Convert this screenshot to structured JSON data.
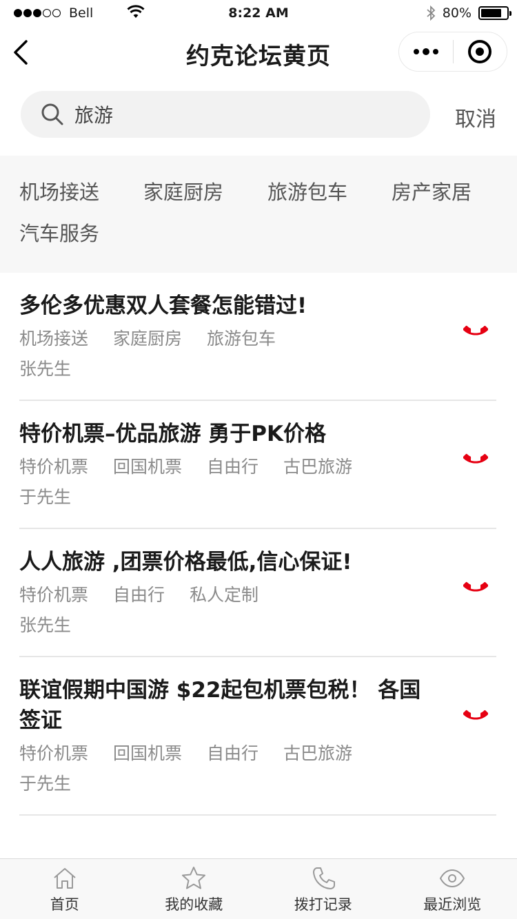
{
  "status_bar": {
    "carrier": "Bell",
    "time": "8:22 AM",
    "battery_pct": "80%",
    "battery_level": 0.8
  },
  "nav": {
    "title": "约克论坛黄页"
  },
  "search": {
    "value": "旅游",
    "cancel_label": "取消"
  },
  "categories": [
    "机场接送",
    "家庭厨房",
    "旅游包车",
    "房产家居",
    "汽车服务"
  ],
  "listings": [
    {
      "title": "多伦多优惠双人套餐怎能错过!",
      "tags": [
        "机场接送",
        "家庭厨房",
        "旅游包车"
      ],
      "person": "张先生"
    },
    {
      "title": "特价机票–优品旅游 勇于PK价格",
      "tags": [
        "特价机票",
        "回国机票",
        "自由行",
        "古巴旅游"
      ],
      "person": "于先生"
    },
    {
      "title": "人人旅游 ,团票价格最低,信心保证!",
      "tags": [
        "特价机票",
        "自由行",
        "私人定制"
      ],
      "person": "张先生"
    },
    {
      "title": "联谊假期中国游 $22起包机票包税！ 各国签证",
      "tags": [
        "特价机票",
        "回国机票",
        "自由行",
        "古巴旅游"
      ],
      "person": "于先生"
    }
  ],
  "tabs": [
    {
      "label": "首页",
      "icon": "home-icon"
    },
    {
      "label": "我的收藏",
      "icon": "star-icon"
    },
    {
      "label": "拨打记录",
      "icon": "phone-icon"
    },
    {
      "label": "最近浏览",
      "icon": "eye-icon"
    }
  ],
  "colors": {
    "accent": "#e60012",
    "text": "#1a1a1a",
    "muted": "#8a8a8a"
  }
}
